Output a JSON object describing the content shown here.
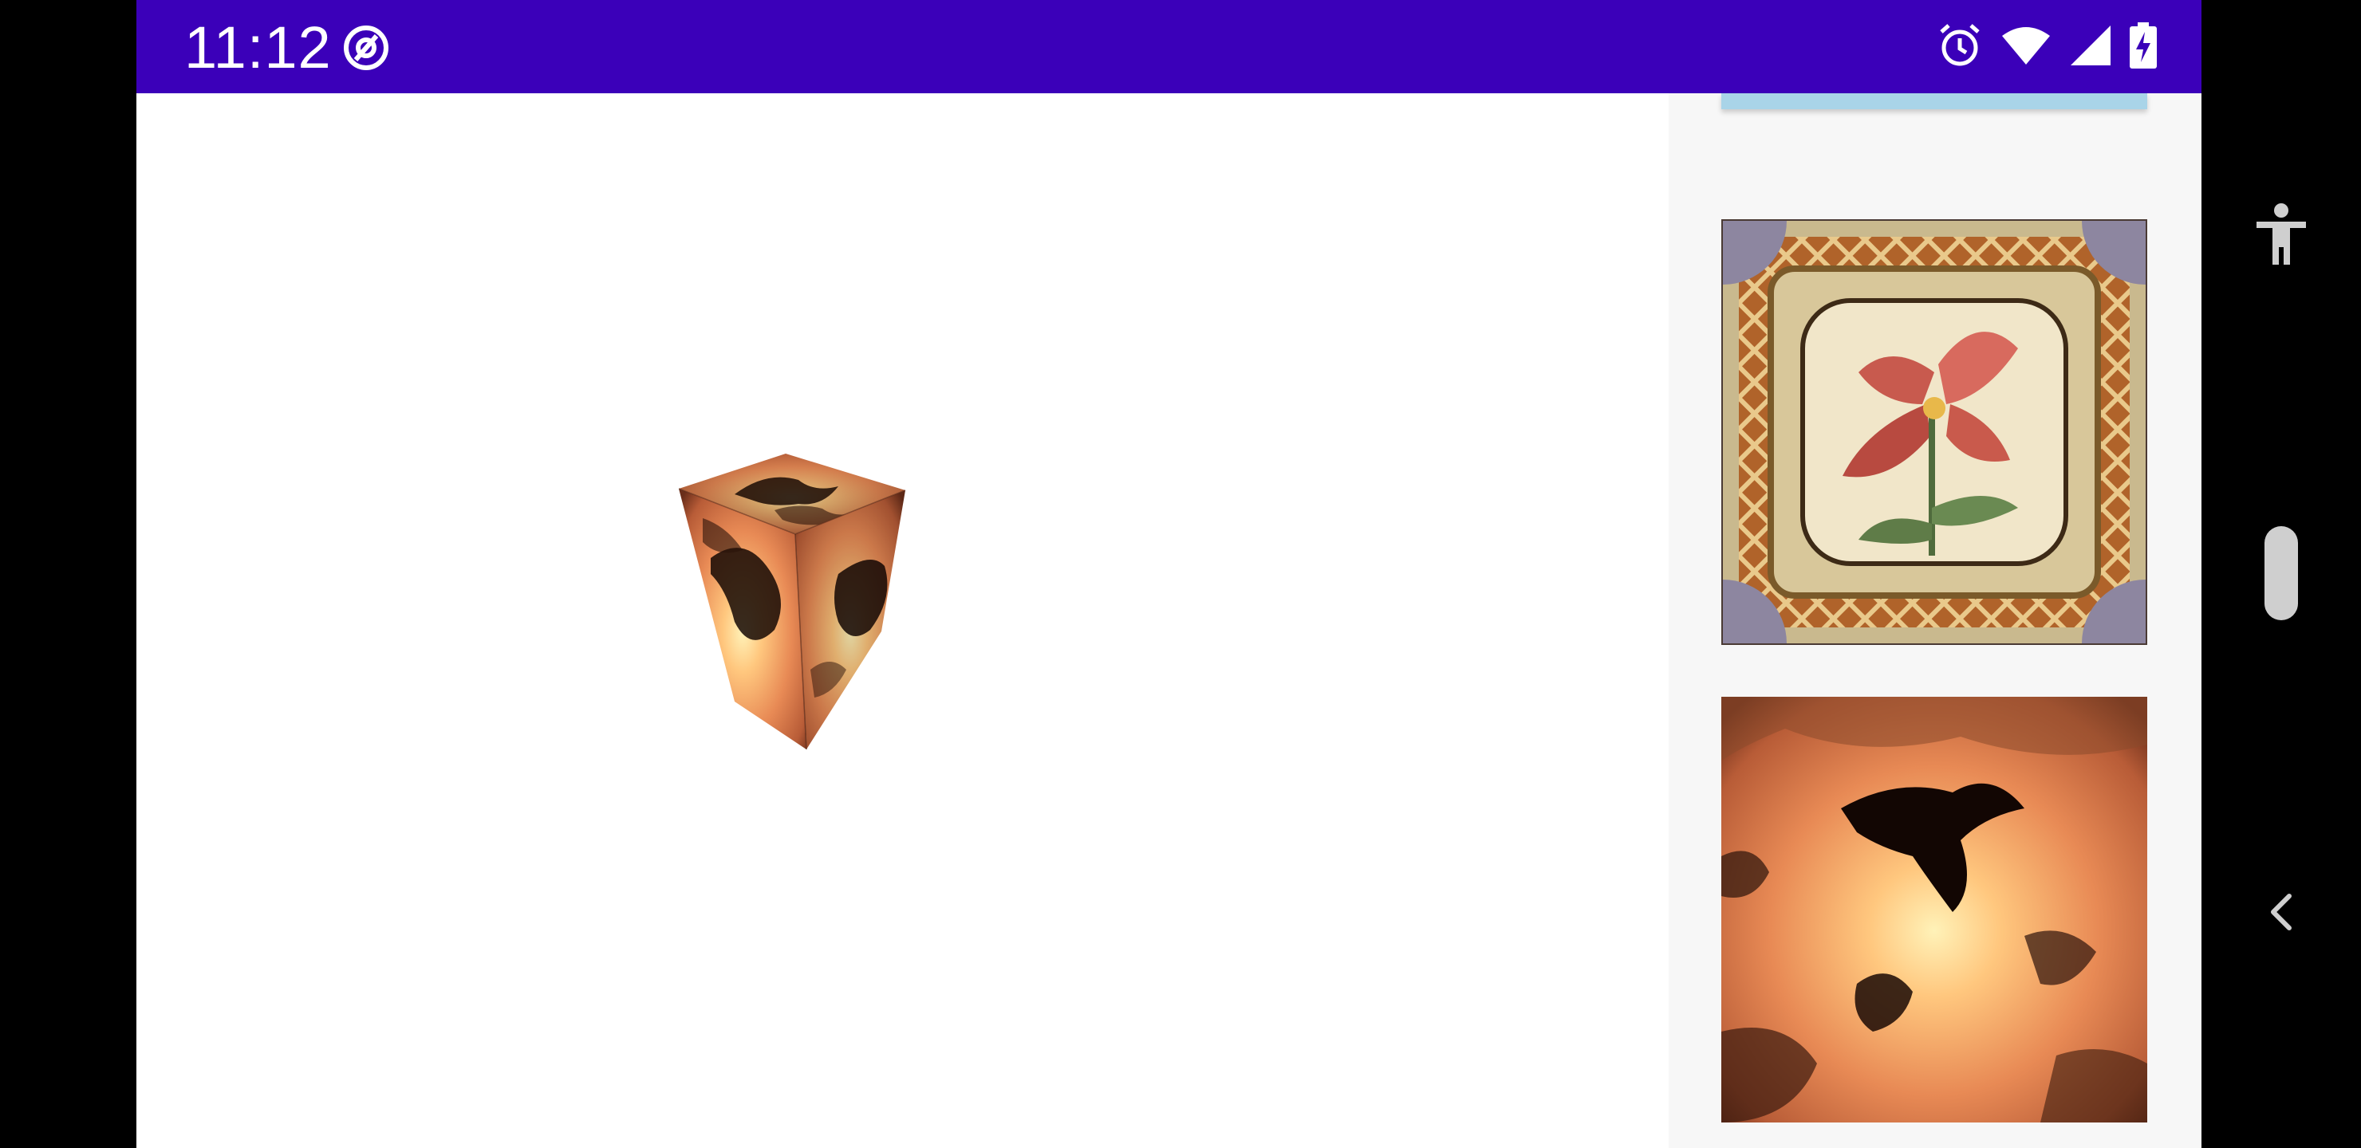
{
  "status_bar": {
    "time": "11:12",
    "left_icon": "at-sign-notification-icon",
    "right_icons": [
      "alarm-icon",
      "wifi-icon",
      "cellular-signal-icon",
      "battery-charging-icon"
    ],
    "background_color": "#3b00b9"
  },
  "viewport": {
    "object": "textured-cube",
    "texture": "nebula"
  },
  "side_panel": {
    "textures": [
      {
        "name": "ornate-floral-tile"
      },
      {
        "name": "nebula"
      }
    ]
  },
  "nav_bar": {
    "buttons": [
      "accessibility-icon",
      "scroll-handle",
      "back-chevron-icon"
    ]
  }
}
